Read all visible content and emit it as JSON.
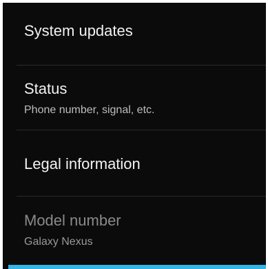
{
  "settings_list": {
    "items": [
      {
        "title": "System updates"
      },
      {
        "title": "Status",
        "subtitle": "Phone number, signal, etc."
      },
      {
        "title": "Legal information"
      },
      {
        "title": "Model number",
        "subtitle": "Galaxy Nexus"
      }
    ]
  },
  "colors": {
    "background": "#0b0b0b",
    "divider": "#2a2a2a",
    "highlight": "#33b5e5"
  }
}
